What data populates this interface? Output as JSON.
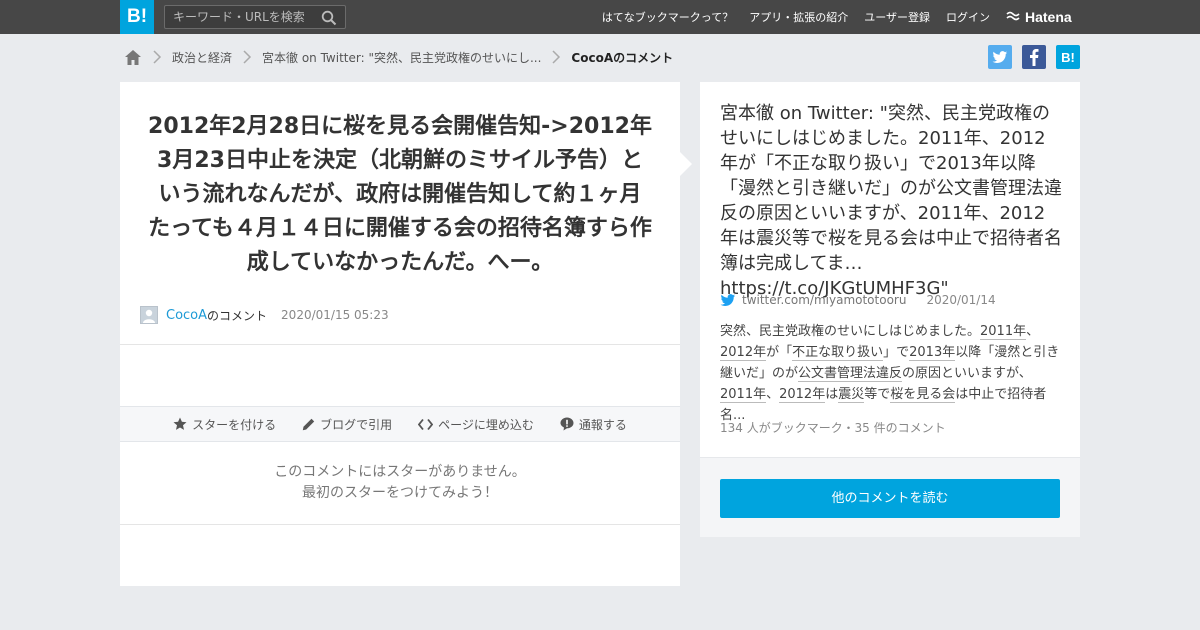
{
  "header": {
    "logo_text": "B!",
    "search_placeholder": "キーワード・URLを検索",
    "nav": [
      "はてなブックマークって？",
      "アプリ・拡張の紹介",
      "ユーザー登録",
      "ログイン"
    ],
    "brand": "Hatena"
  },
  "breadcrumb": {
    "items": [
      "政治と経済",
      "宮本徹 on Twitter: \"突然、民主党政権のせいにし...",
      "CocoAのコメント"
    ]
  },
  "share": {
    "hatena_label": "B!"
  },
  "comment": {
    "text": "2012年2月28日に桜を見る会開催告知->2012年3月23日中止を決定（北朝鮮のミサイル予告）という流れなんだが、政府は開催告知して約１ヶ月たっても４月１４日に開催する会の招待名簿すら作成していなかったんだ。へー。",
    "user": "CocoA",
    "user_suffix": "のコメント",
    "date": "2020/01/15 05:23"
  },
  "actions": [
    "スターを付ける",
    "ブログで引用",
    "ページに埋め込む",
    "通報する"
  ],
  "no_star": {
    "line1": "このコメントにはスターがありません。",
    "line2": "最初のスターをつけてみよう！"
  },
  "entry": {
    "title": "宮本徹 on Twitter: \"突然、民主党政権のせいにしはじめました。2011年、2012年が「不正な取り扱い」で2013年以降「漫然と引き継いだ」のが公文書管理法違反の原因といいますが、2011年、2012年は震災等で桜を見る会は中止で招待者名簿は完成してま… https://t.co/JKGtUMHF3G\"",
    "source": "twitter.com/miyamototooru",
    "date": "2020/01/14",
    "summary": {
      "s1": "突然、民主党政権のせいにしはじめました。",
      "k1": "2011年",
      "s2": "、",
      "k2": "2012年",
      "s3": "が「",
      "k3": "不正な取り扱い",
      "s4": "」で",
      "k4": "2013年",
      "s5": "以降「漫然と引き継いだ」のが",
      "k5": "公文書管理法違反",
      "s6": "の原因といいますが、",
      "k6": "2011年",
      "s7": "、",
      "k7": "2012年",
      "s8": "は",
      "k8": "震災",
      "s9": "等で",
      "k9": "桜を見る会",
      "s10": "は中止で招待者名..."
    },
    "stats": "134 人がブックマーク・35 件のコメント",
    "read_button": "他のコメントを読む"
  },
  "colors": {
    "hatena_blue": "#00a4de",
    "topbar": "#474747",
    "background": "#e9ebee",
    "link": "#1d9ad6",
    "twitter": "#55acee",
    "facebook": "#3b5998"
  }
}
